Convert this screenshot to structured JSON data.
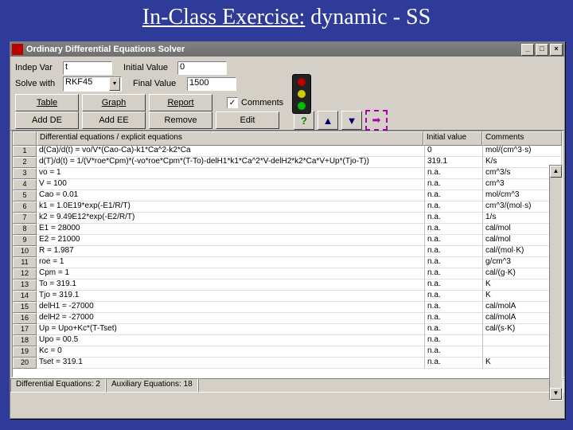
{
  "slide": {
    "title_pre": "In-Class Exercise:",
    "title_rest": " dynamic - SS"
  },
  "window": {
    "title": "Ordinary Differential Equations Solver"
  },
  "form": {
    "indep_lbl": "Indep Var",
    "indep_val": "t",
    "solve_lbl": "Solve with",
    "solve_val": "RKF45",
    "init_lbl": "Initial Value",
    "init_val": "0",
    "final_lbl": "Final Value",
    "final_val": "1500",
    "comments_lbl": "Comments",
    "comments_chk": "✓"
  },
  "toolbar": {
    "table": "Table",
    "graph": "Graph",
    "report": "Report",
    "addde": "Add DE",
    "addee": "Add EE",
    "remove": "Remove",
    "edit": "Edit"
  },
  "icons": {
    "help": "?",
    "up": "▲",
    "dn": "▼",
    "go": "➡"
  },
  "grid": {
    "head_eq": "Differential equations / explicit equations",
    "head_iv": "Initial value",
    "head_cm": "Comments",
    "rows": [
      {
        "n": "1",
        "eq": "d(Ca)/d(t) = vo/V*(Cao-Ca)-k1*Ca^2-k2*Ca",
        "iv": "0",
        "cm": "mol/(cm^3·s)"
      },
      {
        "n": "2",
        "eq": "d(T)/d(t) = 1/(V*roe*Cpm)*(-vo*roe*Cpm*(T-To)-delH1*k1*Ca^2*V-delH2*k2*Ca*V+Up*(Tjo-T))",
        "iv": "319.1",
        "cm": "K/s"
      },
      {
        "n": "3",
        "eq": "vo = 1",
        "iv": "n.a.",
        "cm": "cm^3/s"
      },
      {
        "n": "4",
        "eq": "V = 100",
        "iv": "n.a.",
        "cm": "cm^3"
      },
      {
        "n": "5",
        "eq": "Cao = 0.01",
        "iv": "n.a.",
        "cm": "mol/cm^3"
      },
      {
        "n": "6",
        "eq": "k1 = 1.0E19*exp(-E1/R/T)",
        "iv": "n.a.",
        "cm": "cm^3/(mol·s)"
      },
      {
        "n": "7",
        "eq": "k2 = 9.49E12*exp(-E2/R/T)",
        "iv": "n.a.",
        "cm": "1/s"
      },
      {
        "n": "8",
        "eq": "E1 = 28000",
        "iv": "n.a.",
        "cm": "cal/mol"
      },
      {
        "n": "9",
        "eq": "E2 = 21000",
        "iv": "n.a.",
        "cm": "cal/mol"
      },
      {
        "n": "10",
        "eq": "R = 1.987",
        "iv": "n.a.",
        "cm": "cal/(mol·K)"
      },
      {
        "n": "11",
        "eq": "roe = 1",
        "iv": "n.a.",
        "cm": "g/cm^3"
      },
      {
        "n": "12",
        "eq": "Cpm = 1",
        "iv": "n.a.",
        "cm": "cal/(g·K)"
      },
      {
        "n": "13",
        "eq": "To = 319.1",
        "iv": "n.a.",
        "cm": "K"
      },
      {
        "n": "14",
        "eq": "Tjo = 319.1",
        "iv": "n.a.",
        "cm": "K"
      },
      {
        "n": "15",
        "eq": "delH1 = -27000",
        "iv": "n.a.",
        "cm": "cal/molA"
      },
      {
        "n": "16",
        "eq": "delH2 = -27000",
        "iv": "n.a.",
        "cm": "cal/molA"
      },
      {
        "n": "17",
        "eq": "Up = Upo+Kc*(T-Tset)",
        "iv": "n.a.",
        "cm": "cal/(s·K)"
      },
      {
        "n": "18",
        "eq": "Upo = 00.5",
        "iv": "n.a.",
        "cm": ""
      },
      {
        "n": "19",
        "eq": "Kc = 0",
        "iv": "n.a.",
        "cm": ""
      },
      {
        "n": "20",
        "eq": "Tset = 319.1",
        "iv": "n.a.",
        "cm": "K"
      }
    ]
  },
  "status": {
    "de": "Differential Equations: 2",
    "ae": "Auxiliary Equations: 18"
  }
}
